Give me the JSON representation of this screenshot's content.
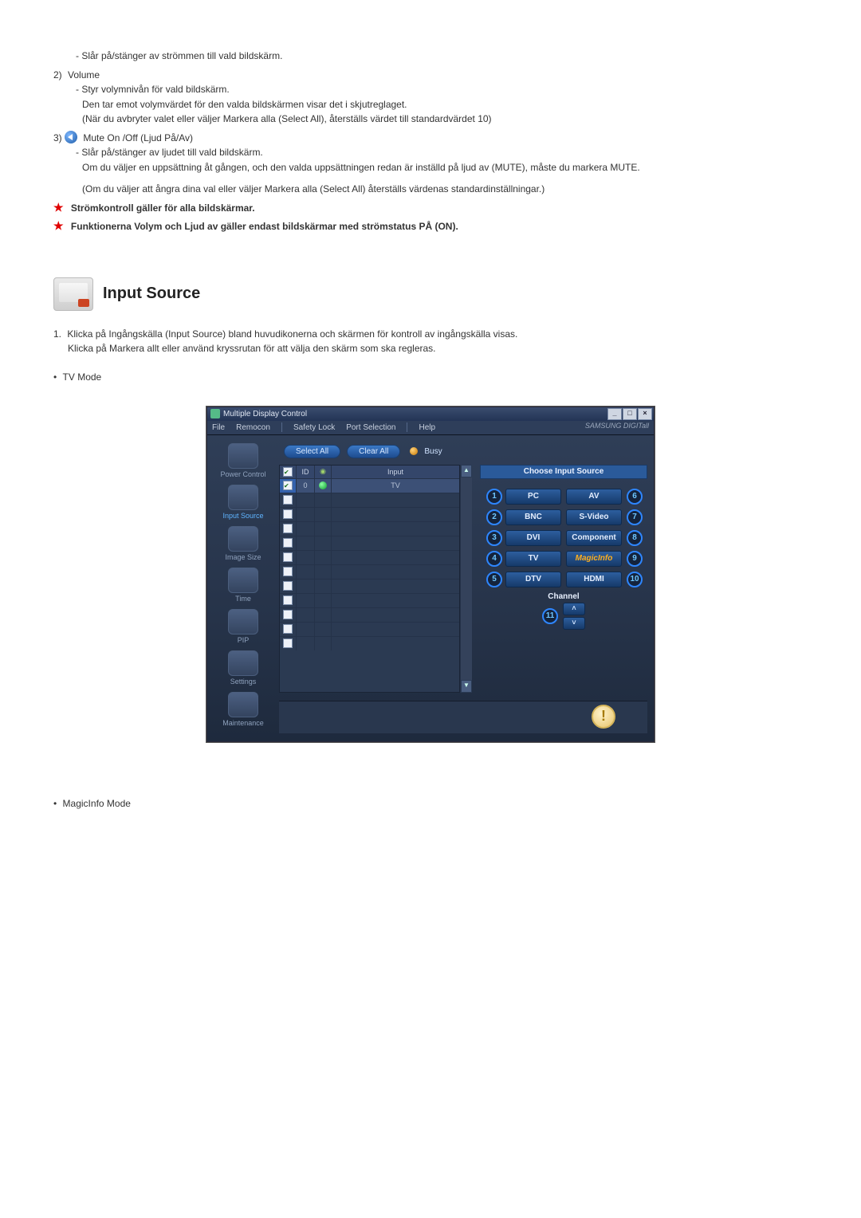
{
  "intro": {
    "power_desc": "- Slår på/stänger av strömmen till vald bildskärm.",
    "item2_num": "2)",
    "item2_title": "Volume",
    "vol_l1": "- Styr volymnivån för vald bildskärm.",
    "vol_l2": "Den tar emot volymvärdet för den valda bildskärmen visar det i skjutreglaget.",
    "vol_l3": "(När du avbryter valet eller väljer Markera alla (Select All), återställs värdet till standardvärdet 10)",
    "item3_num": "3)",
    "item3_title": "Mute On /Off (Ljud På/Av)",
    "mute_l1": "- Slår på/stänger av ljudet till vald bildskärm.",
    "mute_l2": "Om du väljer en uppsättning åt gången, och den valda uppsättningen redan är inställd på ljud av (MUTE), måste du markera MUTE.",
    "mute_l3": "(Om du väljer att ångra dina val eller väljer Markera alla (Select All) återställs värdenas standardinställningar.)",
    "star1": "Strömkontroll gäller för alla bildskärmar.",
    "star2": "Funktionerna Volym och Ljud av gäller endast bildskärmar med strömstatus PÅ (ON)."
  },
  "section": {
    "title": "Input Source",
    "ol_num": "1.",
    "ol_l1": "Klicka på Ingångskälla (Input Source) bland huvudikonerna och skärmen för kontroll av ingångskälla visas.",
    "ol_l2": "Klicka på Markera allt eller använd kryssrutan för att välja den skärm som ska regleras.",
    "bullet_tv": "TV Mode",
    "bullet_magic": "MagicInfo Mode"
  },
  "win": {
    "title": "Multiple Display Control",
    "menus": [
      "File",
      "Remocon",
      "Safety Lock",
      "Port Selection",
      "Help"
    ],
    "brand": "SAMSUNG DIGITall",
    "select_all": "Select All",
    "clear_all": "Clear All",
    "busy": "Busy",
    "sidebar": [
      "Power Control",
      "Input Source",
      "Image Size",
      "Time",
      "PIP",
      "Settings",
      "Maintenance"
    ],
    "list_header": {
      "id": "ID",
      "input": "Input"
    },
    "row": {
      "id": "0",
      "input": "TV"
    },
    "right_title": "Choose Input Source",
    "sources": {
      "1": "PC",
      "2": "BNC",
      "3": "DVI",
      "4": "TV",
      "5": "DTV",
      "6": "AV",
      "7": "S-Video",
      "8": "Component",
      "9": "MagicInfo",
      "10": "HDMI"
    },
    "channel_label": "Channel",
    "ch_num": "11"
  }
}
